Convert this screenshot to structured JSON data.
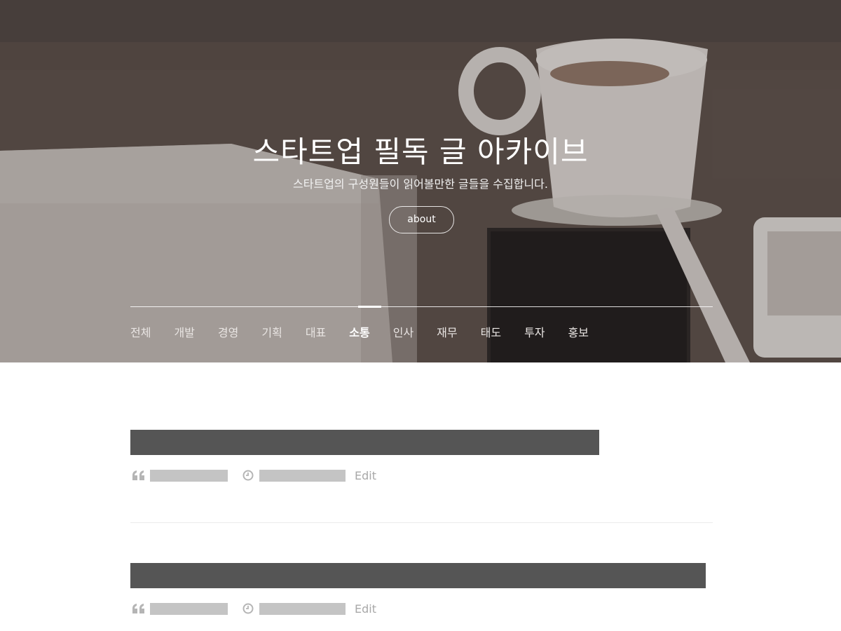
{
  "header": {
    "title": "스타트업 필독 글 아카이브",
    "subtitle": "스타트업의 구성원들이 읽어볼만한 글들을 수집합니다.",
    "about_label": "about"
  },
  "nav": {
    "items": [
      "전체",
      "개발",
      "경영",
      "기획",
      "대표",
      "소통",
      "인사",
      "재무",
      "태도",
      "투자",
      "홍보"
    ],
    "active": "소통"
  },
  "posts": [
    {
      "author_icon": "quote-icon",
      "date_icon": "clock-icon",
      "edit_label": "Edit"
    },
    {
      "author_icon": "quote-icon",
      "date_icon": "clock-icon",
      "edit_label": "Edit"
    }
  ],
  "colors": {
    "title_bar": "#555555",
    "redacted": "#c4c4c4",
    "meta_text": "#a8a8a8"
  }
}
